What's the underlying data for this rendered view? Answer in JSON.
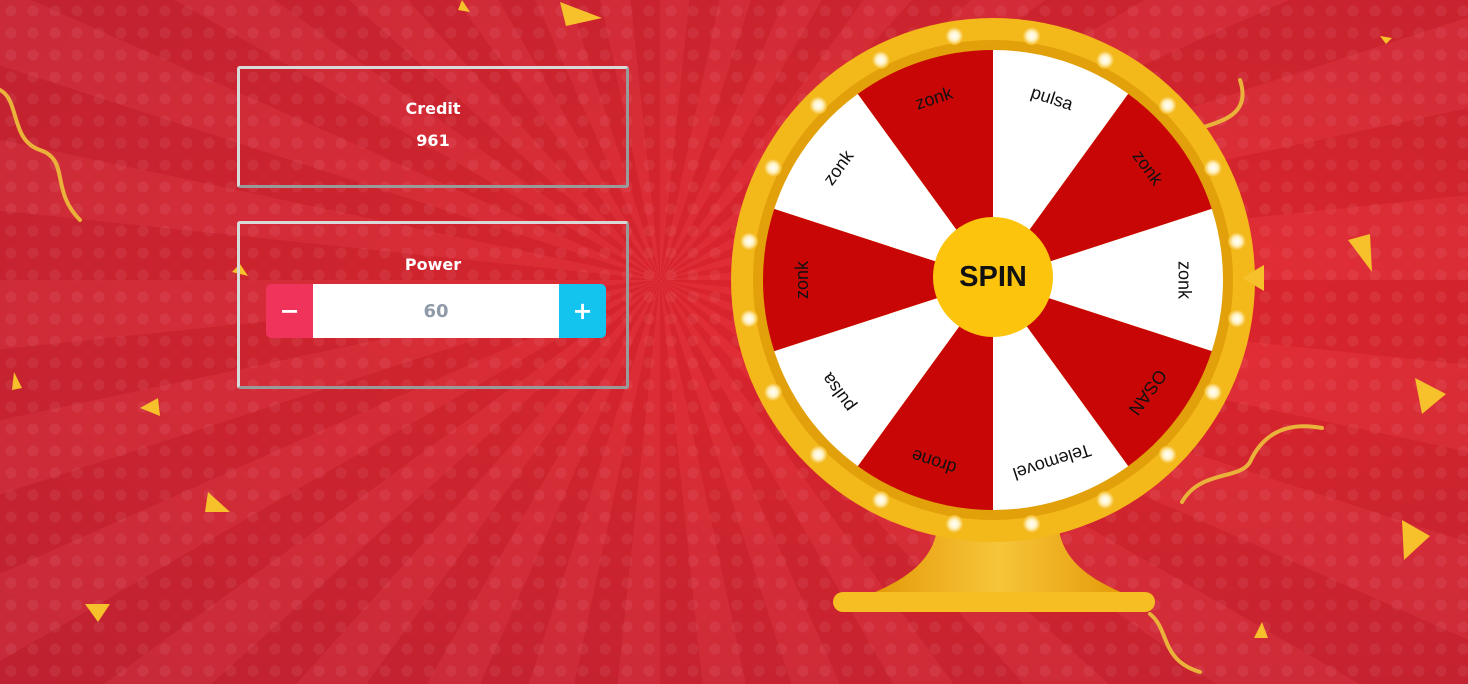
{
  "credit": {
    "label": "Credit",
    "value": "961"
  },
  "power": {
    "label": "Power",
    "value": "60",
    "minus_label": "−",
    "plus_label": "+"
  },
  "wheel": {
    "spin_label": "SPIN",
    "segments": [
      "pulsa",
      "zonk",
      "zonk",
      "OSAN",
      "Telemovel",
      "drone",
      "pulsa",
      "zonk",
      "zonk",
      "zonk"
    ],
    "colors": {
      "red": "#c90606",
      "white": "#ffffff",
      "rim": "#f3b81a",
      "hub": "#fdc40d"
    }
  }
}
